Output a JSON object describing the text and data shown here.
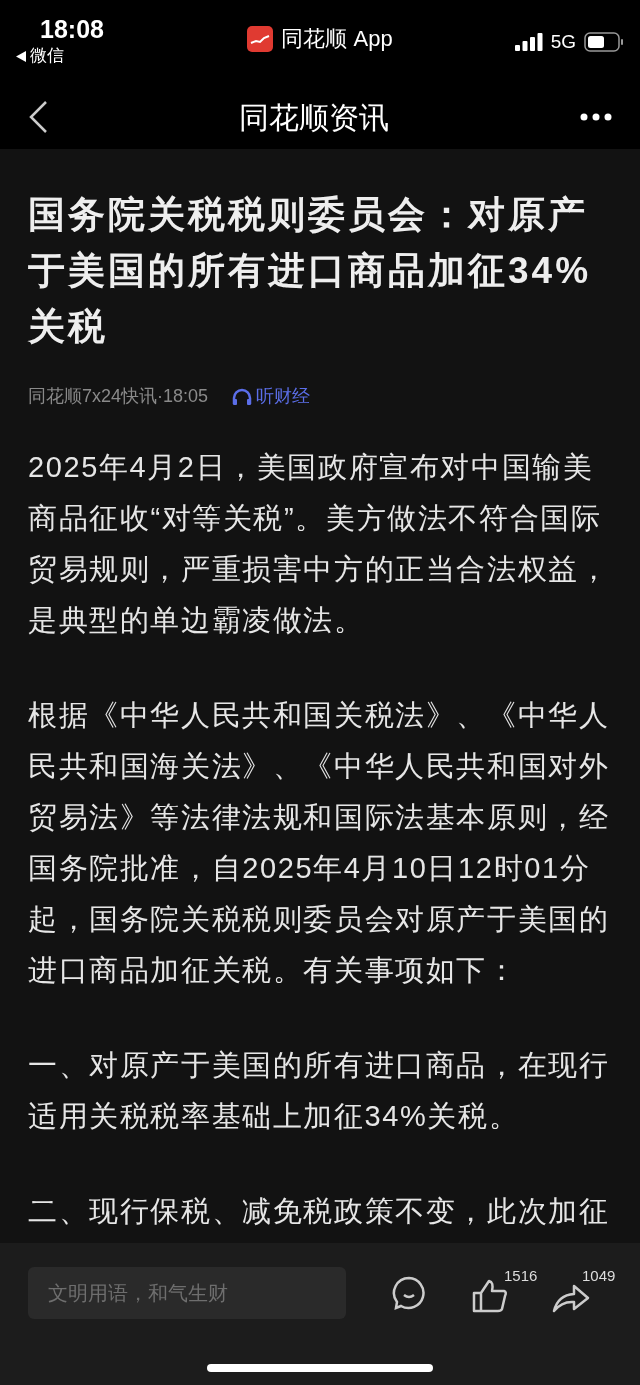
{
  "status_bar": {
    "time": "18:08",
    "back_app": "微信",
    "app_name": "同花顺 App",
    "network": "5G"
  },
  "nav": {
    "title": "同花顺资讯"
  },
  "article": {
    "title": "国务院关税税则委员会：对原产于美国的所有进口商品加征34%关税",
    "source": "同花顺7x24快讯·18:05",
    "listen": "听财经",
    "paragraphs": [
      "2025年4月2日，美国政府宣布对中国输美商品征收“对等关税”。美方做法不符合国际贸易规则，严重损害中方的正当合法权益，是典型的单边霸凌做法。",
      "根据《中华人民共和国关税法》、《中华人民共和国海关法》、《中华人民共和国对外贸易法》等法律法规和国际法基本原则，经国务院批准，自2025年4月10日12时01分起，国务院关税税则委员会对原产于美国的进口商品加征关税。有关事项如下：",
      "一、对原产于美国的所有进口商品，在现行适用关税税率基础上加征34%关税。",
      "二、现行保税、减免税政策不变，此次加征"
    ]
  },
  "bottom_bar": {
    "comment_placeholder": "文明用语，和气生财",
    "likes": "1516",
    "shares": "1049"
  }
}
